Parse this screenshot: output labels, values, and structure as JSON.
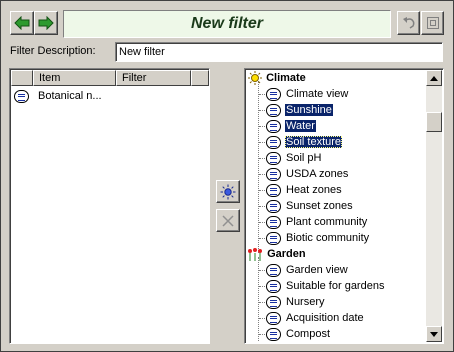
{
  "toolbar": {
    "back_icon": "left-arrow-icon",
    "forward_icon": "right-arrow-icon",
    "undo_icon": "undo-icon",
    "stop_icon": "stop-icon"
  },
  "title": "New filter",
  "description": {
    "label": "Filter Description:",
    "value": "New filter"
  },
  "filter_list": {
    "columns": [
      "Item",
      "Filter"
    ],
    "rows": [
      {
        "item": "Botanical n...",
        "filter": ""
      }
    ]
  },
  "middle_buttons": {
    "add_icon": "sun-add-icon",
    "remove_icon": "x-remove-icon"
  },
  "tree": {
    "categories": [
      {
        "label": "Climate",
        "icon": "sun-icon",
        "items": [
          {
            "label": "Climate view",
            "selected": false
          },
          {
            "label": "Sunshine",
            "selected": true
          },
          {
            "label": "Water",
            "selected": true
          },
          {
            "label": "Soil texture",
            "selected": true
          },
          {
            "label": "Soil pH",
            "selected": false
          },
          {
            "label": "USDA zones",
            "selected": false
          },
          {
            "label": "Heat zones",
            "selected": false
          },
          {
            "label": "Sunset zones",
            "selected": false
          },
          {
            "label": "Plant community",
            "selected": false
          },
          {
            "label": "Biotic community",
            "selected": false
          }
        ]
      },
      {
        "label": "Garden",
        "icon": "flowers-icon",
        "items": [
          {
            "label": "Garden view",
            "selected": false
          },
          {
            "label": "Suitable for gardens",
            "selected": false
          },
          {
            "label": "Nursery",
            "selected": false
          },
          {
            "label": "Acquisition date",
            "selected": false
          },
          {
            "label": "Compost",
            "selected": false
          }
        ]
      }
    ]
  },
  "colors": {
    "selection": "#0a246a",
    "title_bg": "#eef8e8",
    "arrow_green": "#2e9a2e"
  }
}
